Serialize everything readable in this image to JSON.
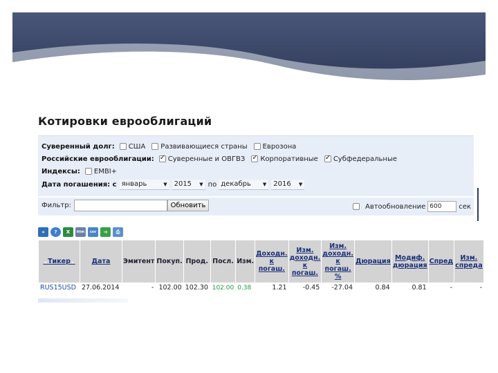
{
  "page_title": "Котировки еврооблигаций",
  "filters": {
    "sovereign": {
      "label": "Суверенный долг:",
      "options": [
        {
          "label": "США",
          "checked": false
        },
        {
          "label": "Развивающиеся страны",
          "checked": false
        },
        {
          "label": "Еврозона",
          "checked": false
        }
      ]
    },
    "russian": {
      "label": "Российские еврооблигации:",
      "options": [
        {
          "label": "Суверенные и ОВГВЗ",
          "checked": true
        },
        {
          "label": "Корпоративные",
          "checked": true
        },
        {
          "label": "Субфедеральные",
          "checked": true
        }
      ]
    },
    "indexes": {
      "label": "Индексы:",
      "options": [
        {
          "label": "EMBI+",
          "checked": false
        }
      ]
    },
    "maturity": {
      "label": "Дата погашения: с",
      "from_month": "январь",
      "from_year": "2015",
      "to_text": "по",
      "to_month": "декабрь",
      "to_year": "2016"
    }
  },
  "filter_bar": {
    "filter_label": "Фильтр:",
    "filter_value": "",
    "refresh_label": "Обновить",
    "autorefresh_label": "Автообновление",
    "autorefresh_checked": false,
    "autorefresh_value": "600",
    "seconds_label": "сек"
  },
  "toolbar_icons": [
    "back-icon",
    "help-icon",
    "excel-icon",
    "html-icon",
    "csv-icon",
    "export-icon",
    "print-icon"
  ],
  "table": {
    "headers": [
      "Тикер",
      "Дата",
      "Эмитент",
      "Покуп.",
      "Прод.",
      "Посл.",
      "Изм.",
      "Доходн. к погаш.",
      "Изм. доходн. к погаш.",
      "Изм. доходн. к погаш. %",
      "Дюрация",
      "Модиф. дюрация",
      "Спред",
      "Изм. спреда"
    ],
    "rows": [
      [
        "RUS15USD",
        "27.06.2014",
        "-",
        "102.00",
        "102.30",
        "102.00",
        "0.38",
        "1.21",
        "-0.45",
        "-27.04",
        "0.84",
        "0.81",
        "-",
        "-"
      ]
    ]
  },
  "colors": {
    "banner": "#3f4b6e",
    "panel": "#e8eef8",
    "header_bg": "#d3d3d3",
    "link": "#1f4fa0",
    "positive": "#1d9a3c"
  }
}
